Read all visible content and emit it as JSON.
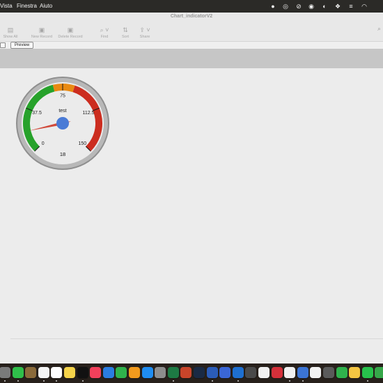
{
  "menubar": {
    "items": [
      "Vista",
      "Finestra",
      "Aiuto"
    ],
    "status_icons": [
      "record-icon",
      "creative-cloud-icon",
      "slash-icon",
      "avatar-icon",
      "eye-icon",
      "dropbox-icon",
      "sliders-icon",
      "wifi-icon"
    ]
  },
  "window": {
    "title": "Chart_indicatorV2"
  },
  "toolbar": {
    "show_all": "Show All",
    "new_record": "New Record",
    "delete_record": "Delete Record",
    "find": "Find",
    "sort": "Sort",
    "share": "Share"
  },
  "layout_bar": {
    "preview": "Preview"
  },
  "gauge": {
    "title": "test",
    "value": 18,
    "value_label": "18",
    "min": 0,
    "max": 150,
    "tick_labels": [
      "0",
      "37.5",
      "75",
      "112.5",
      "150"
    ],
    "bands": [
      {
        "from": 0,
        "to": 67,
        "color": "#27a22b"
      },
      {
        "from": 67,
        "to": 85,
        "color": "#e98a12"
      },
      {
        "from": 85,
        "to": 150,
        "color": "#cc2d1f"
      }
    ],
    "colors": {
      "rim": "#b8b8b8",
      "face": "#ebebeb",
      "needle": "#d14a3b",
      "hub": "#4a7bd6"
    }
  },
  "dock": {
    "icons": [
      {
        "name": "settings-icon",
        "color": "#7a7a7a"
      },
      {
        "name": "facetime-icon",
        "color": "#2fbf4a"
      },
      {
        "name": "folder-icon",
        "color": "#8a6a3a"
      },
      {
        "name": "calendar-icon",
        "color": "#f4f4f4"
      },
      {
        "name": "reminders-icon",
        "color": "#ffffff"
      },
      {
        "name": "notes-icon",
        "color": "#f5d34a"
      },
      {
        "name": "apple-tv-icon",
        "color": "#111111"
      },
      {
        "name": "music-icon",
        "color": "#f2405b"
      },
      {
        "name": "keynote-icon",
        "color": "#2a7de1"
      },
      {
        "name": "numbers-icon",
        "color": "#2fb24c"
      },
      {
        "name": "pages-icon",
        "color": "#f29a1d"
      },
      {
        "name": "app-store-icon",
        "color": "#1f8cf0"
      },
      {
        "name": "system-preferences-icon",
        "color": "#8d8d8d"
      },
      {
        "name": "excel-icon",
        "color": "#1d7a44"
      },
      {
        "name": "powerpoint-icon",
        "color": "#c8452a"
      },
      {
        "name": "dev-tool-icon",
        "color": "#1a2a44"
      },
      {
        "name": "word-icon",
        "color": "#2b5cb8"
      },
      {
        "name": "pen-tool-icon",
        "color": "#3a66d6"
      },
      {
        "name": "outlook-icon",
        "color": "#1e6fd0"
      },
      {
        "name": "quicktime-icon",
        "color": "#4a4a4a"
      },
      {
        "name": "filemaker-icon",
        "color": "#f0f0f0"
      },
      {
        "name": "shield-app-icon",
        "color": "#d4303a"
      },
      {
        "name": "filemaker-pro-icon",
        "color": "#f0f0f0"
      },
      {
        "name": "preview-icon",
        "color": "#3b74d4"
      },
      {
        "name": "chrome-icon",
        "color": "#f2f2f2"
      },
      {
        "name": "quicktime-player-icon",
        "color": "#5a5a5a"
      },
      {
        "name": "filemaker-green-icon",
        "color": "#2fb24c"
      },
      {
        "name": "stickies-icon",
        "color": "#f4c542"
      },
      {
        "name": "whatsapp-icon",
        "color": "#27c24c"
      },
      {
        "name": "close-circle-icon",
        "color": "#36a74a"
      },
      {
        "name": "spreadsheet-icon",
        "color": "#1f7a4a"
      }
    ]
  }
}
